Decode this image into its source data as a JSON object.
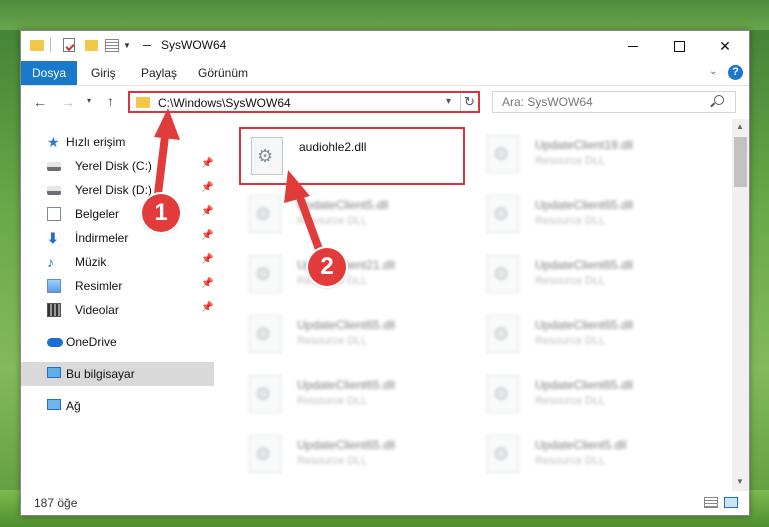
{
  "window": {
    "title": "SysWOW64",
    "controls": {
      "minimize": "",
      "maximize": "",
      "close": "✕"
    }
  },
  "ribbon": {
    "tabs": [
      {
        "label": "Dosya"
      },
      {
        "label": "Giriş"
      },
      {
        "label": "Paylaş"
      },
      {
        "label": "Görünüm"
      }
    ],
    "help": "?"
  },
  "nav": {
    "back": "←",
    "forward": "→",
    "recent": "▾",
    "up": "↑",
    "address": "C:\\Windows\\SysWOW64",
    "dropdown": "▾",
    "refresh": "↻",
    "search_placeholder": "Ara: SysWOW64"
  },
  "sidebar": {
    "items": [
      {
        "label": "Hızlı erişim",
        "icon": "star-icon",
        "pinned": false
      },
      {
        "label": "Yerel Disk (C:)",
        "icon": "disk-icon",
        "pinned": true
      },
      {
        "label": "Yerel Disk (D:)",
        "icon": "disk-icon",
        "pinned": true
      },
      {
        "label": "Belgeler",
        "icon": "documents-icon",
        "pinned": true
      },
      {
        "label": "İndirmeler",
        "icon": "download-icon",
        "pinned": true
      },
      {
        "label": "Müzik",
        "icon": "music-icon",
        "pinned": true
      },
      {
        "label": "Resimler",
        "icon": "pictures-icon",
        "pinned": true
      },
      {
        "label": "Videolar",
        "icon": "videos-icon",
        "pinned": true
      },
      {
        "label": "OneDrive",
        "icon": "cloud-icon",
        "pinned": false
      },
      {
        "label": "Bu bilgisayar",
        "icon": "computer-icon",
        "pinned": false
      },
      {
        "label": "Ağ",
        "icon": "network-icon",
        "pinned": false
      }
    ],
    "pin_glyph": "📌"
  },
  "files": [
    {
      "name": "audiohle2.dll",
      "type": ""
    },
    {
      "name": "UpdateClient19.dll",
      "type": "Resource DLL"
    },
    {
      "name": "UpdateClient5.dll",
      "type": "Resource DLL"
    },
    {
      "name": "UpdateClient65.dll",
      "type": "Resource DLL"
    },
    {
      "name": "UpdateClient21.dll",
      "type": "Resource DLL"
    },
    {
      "name": "UpdateClient65.dll",
      "type": "Resource DLL"
    },
    {
      "name": "UpdateClient65.dll",
      "type": "Resource DLL"
    },
    {
      "name": "UpdateClient65.dll",
      "type": "Resource DLL"
    },
    {
      "name": "UpdateClient65.dll",
      "type": "Resource DLL"
    },
    {
      "name": "UpdateClient65.dll",
      "type": "Resource DLL"
    },
    {
      "name": "UpdateClient65.dll",
      "type": "Resource DLL"
    },
    {
      "name": "UpdateClient5.dll",
      "type": "Resource DLL"
    }
  ],
  "status": {
    "count": "187 öğe"
  },
  "annotations": {
    "step1": "1",
    "step2": "2",
    "color": "#e23b3b"
  }
}
